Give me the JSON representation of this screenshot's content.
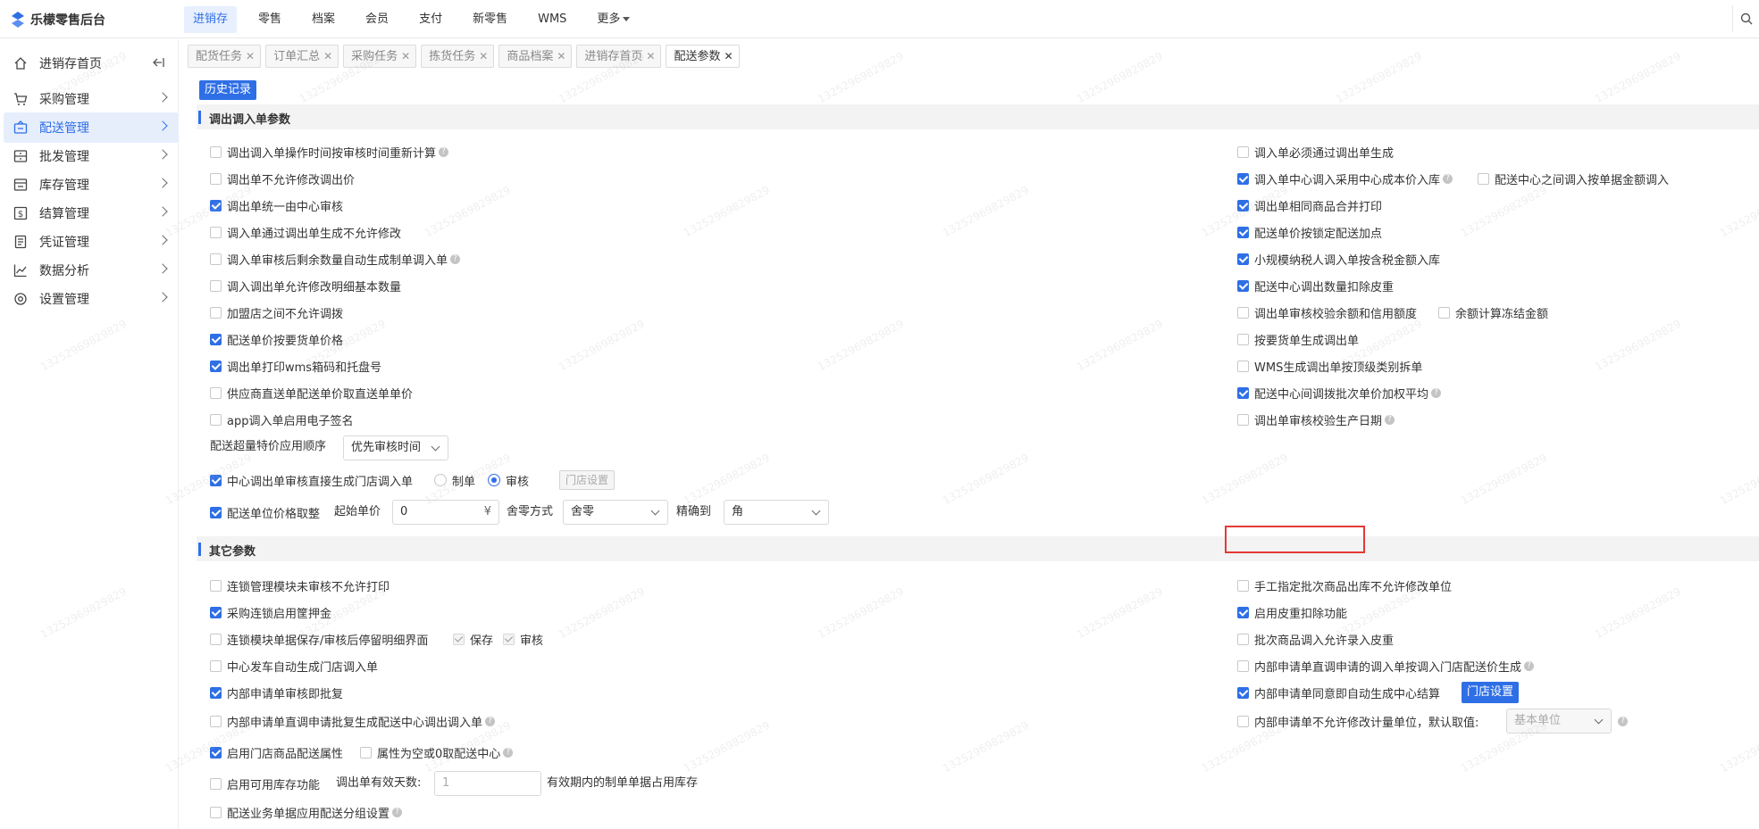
{
  "app": {
    "title": "乐檬零售后台"
  },
  "topnav": [
    "进销存",
    "零售",
    "档案",
    "会员",
    "支付",
    "新零售",
    "WMS",
    "更多"
  ],
  "sidebar": {
    "items": [
      "进销存首页",
      "采购管理",
      "配送管理",
      "批发管理",
      "库存管理",
      "结算管理",
      "凭证管理",
      "数据分析",
      "设置管理"
    ]
  },
  "tabs": [
    "配货任务",
    "订单汇总",
    "采购任务",
    "拣货任务",
    "商品档案",
    "进销存首页",
    "配送参数"
  ],
  "history_button": "历史记录",
  "section1": {
    "title": "调出调入单参数",
    "left": [
      "调出调入单操作时间按审核时间重新计算",
      "调出单不允许修改调出价",
      "调出单统一由中心审核",
      "调入单通过调出单生成不允许修改",
      "调入单审核后剩余数量自动生成制单调入单",
      "调入调出单允许修改明细基本数量",
      "加盟店之间不允许调拨",
      "配送单价按要货单价格",
      "调出单打印wms箱码和托盘号",
      "供应商直送单配送单价取直送单单价",
      "app调入单启用电子签名"
    ],
    "right": [
      "调入单必须通过调出单生成",
      "调入单中心调入采用中心成本价入库",
      "配送中心之间调入按单据金额调入",
      "调出单相同商品合并打印",
      "配送单价按锁定配送加点",
      "小规模纳税人调入单按含税金额入库",
      "配送中心调出数量扣除皮重",
      "调出单审核校验余额和信用额度",
      "余额计算冻结金额",
      "按要货单生成调出单",
      "WMS生成调出单按顶级类别拆单",
      "配送中心间调拨批次单价加权平均",
      "调出单审核校验生产日期"
    ],
    "overprice_label": "配送超量特价应用顺序",
    "overprice_value": "优先审核时间",
    "center_audit_label": "中心调出单审核直接生成门店调入单",
    "radio_make": "制单",
    "radio_audit": "审核",
    "store_settings": "门店设置",
    "price_round_label": "配送单位价格取整",
    "start_price_label": "起始单价",
    "start_price_value": "0",
    "currency": "¥",
    "rounding_method_label": "舍零方式",
    "rounding_method_value": "舍零",
    "precision_label": "精确到",
    "precision_value": "角"
  },
  "section2": {
    "title": "其它参数",
    "left": [
      "连锁管理模块未审核不允许打印",
      "采购连锁启用筐押金",
      "连锁模块单据保存/审核后停留明细界面",
      "保存",
      "审核",
      "中心发车自动生成门店调入单",
      "内部申请单审核即批复",
      "内部申请单直调申请批复生成配送中心调出调入单",
      "启用门店商品配送属性",
      "属性为空或0取配送中心",
      "启用可用库存功能",
      "配送业务单据应用配送分组设置"
    ],
    "valid_days_label": "调出单有效天数:",
    "valid_days_value": "1",
    "valid_days_suffix": "有效期内的制单单据占用库存",
    "right": [
      "手工指定批次商品出库不允许修改单位",
      "启用皮重扣除功能",
      "批次商品调入允许录入皮重",
      "内部申请单直调申请的调入单按调入门店配送价生成",
      "内部申请单同意即自动生成中心结算",
      "内部申请单不允许修改计量单位，默认取值:"
    ],
    "store_settings_btn": "门店设置",
    "default_unit_value": "基本单位"
  },
  "watermark": "13252969829829",
  "colors": {
    "accent": "#2f6fe6",
    "highlight": "#e53935"
  }
}
